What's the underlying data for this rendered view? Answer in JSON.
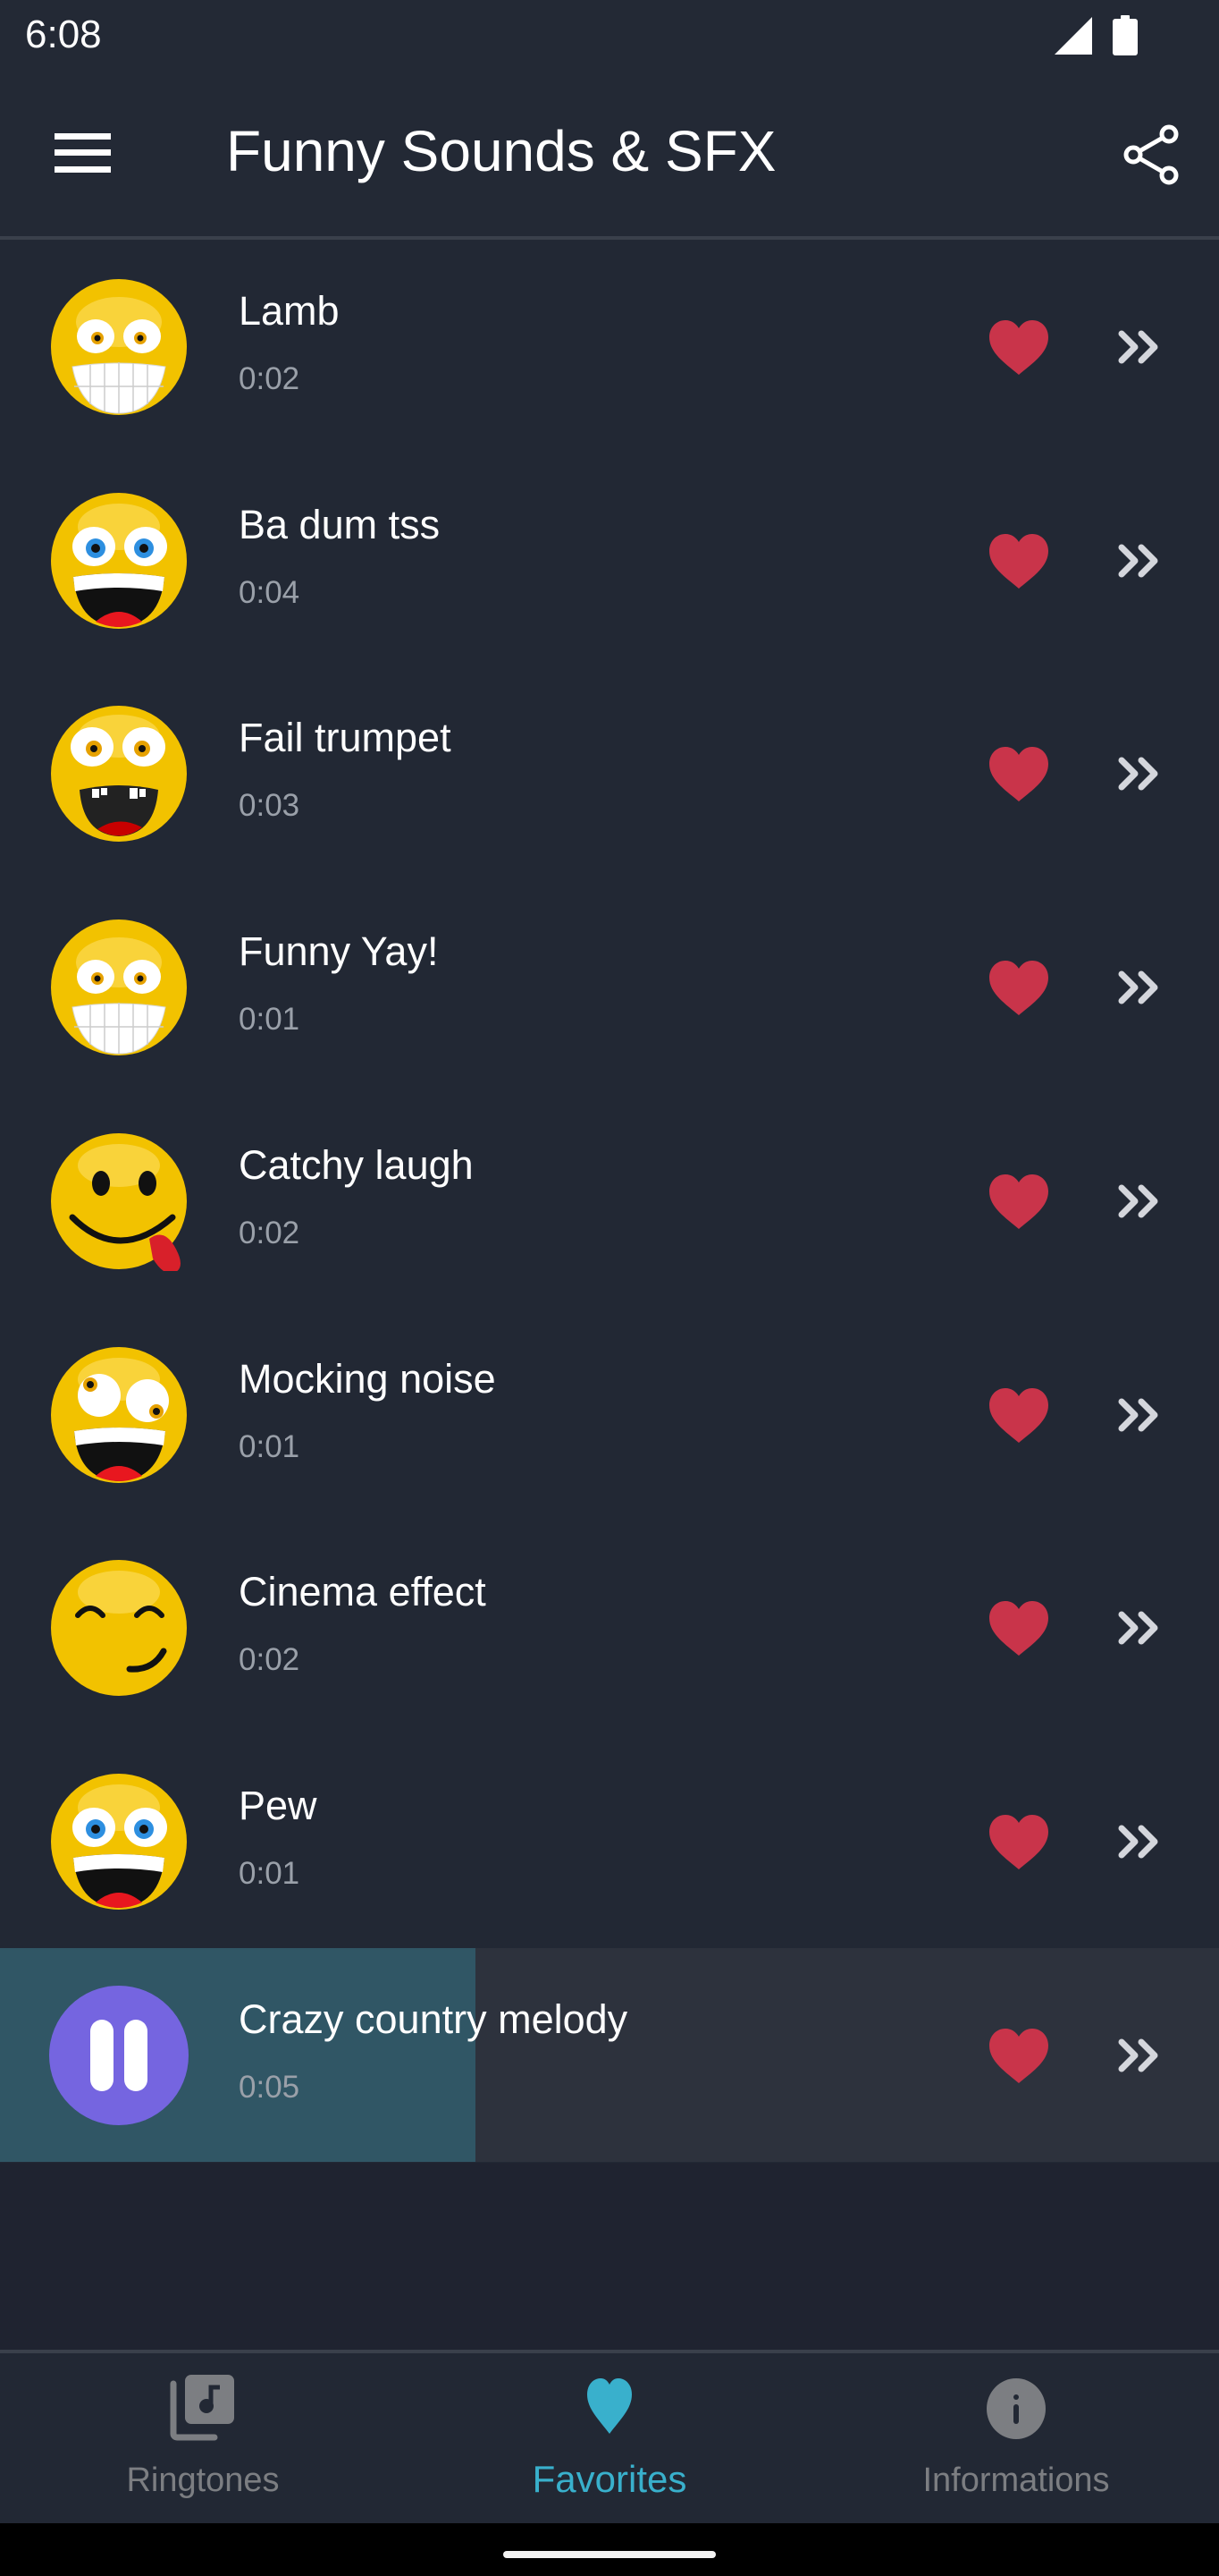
{
  "status_bar": {
    "time": "6:08",
    "icons": [
      "signal-icon",
      "battery-icon"
    ]
  },
  "app_bar": {
    "menu_icon": "hamburger-menu-icon",
    "title": "Funny Sounds & SFX",
    "share_icon": "share-icon"
  },
  "colors": {
    "background": "#222834",
    "heart": "#c9344a",
    "accent": "#39b0cc",
    "progress_fill": "#305665",
    "play_button": "#7565e0",
    "inactive_nav": "#7c7e82"
  },
  "sounds": [
    {
      "title": "Lamb",
      "duration": "0:02",
      "avatar": "grinning-teeth-emoji",
      "favorite": true
    },
    {
      "title": "Ba dum tss",
      "duration": "0:04",
      "avatar": "laughing-blue-eyes-emoji",
      "favorite": true
    },
    {
      "title": "Fail trumpet",
      "duration": "0:03",
      "avatar": "gap-toothed-laughing-emoji",
      "favorite": true
    },
    {
      "title": "Funny Yay!",
      "duration": "0:01",
      "avatar": "grinning-teeth-emoji",
      "favorite": true
    },
    {
      "title": "Catchy laugh",
      "duration": "0:02",
      "avatar": "tongue-out-emoji",
      "favorite": true
    },
    {
      "title": "Mocking noise",
      "duration": "0:01",
      "avatar": "crazy-eyes-laughing-emoji",
      "favorite": true
    },
    {
      "title": "Cinema effect",
      "duration": "0:02",
      "avatar": "smirking-emoji",
      "favorite": true
    },
    {
      "title": "Pew",
      "duration": "0:01",
      "avatar": "laughing-blue-eyes-emoji",
      "favorite": true
    },
    {
      "title": "Crazy country melody",
      "duration": "0:05",
      "avatar": "pause-icon",
      "favorite": true,
      "playing": true,
      "progress": 0.39
    }
  ],
  "bottom_nav": {
    "items": [
      {
        "label": "Ringtones",
        "icon": "music-library-icon",
        "active": false
      },
      {
        "label": "Favorites",
        "icon": "heart-icon",
        "active": true
      },
      {
        "label": "Informations",
        "icon": "info-icon",
        "active": false
      }
    ]
  }
}
